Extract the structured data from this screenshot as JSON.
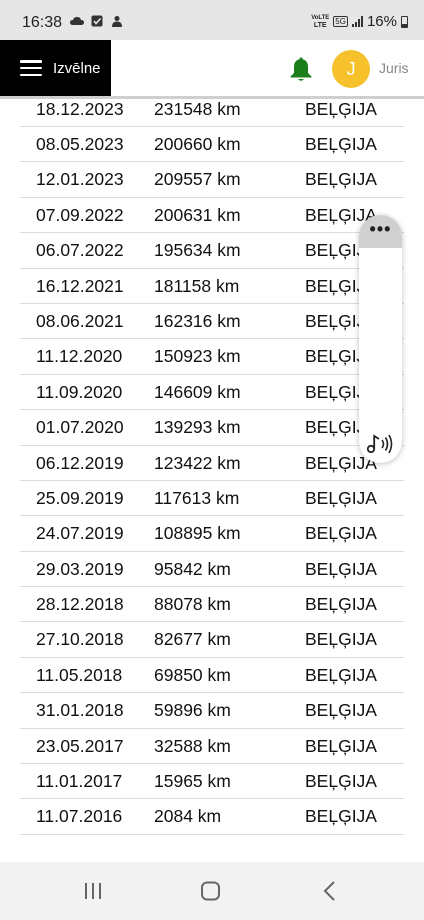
{
  "status_bar": {
    "time": "16:38",
    "network_top": "VoLTE",
    "network_bottom": "LTE",
    "network_type": "5G",
    "battery_percent": "16%"
  },
  "app_bar": {
    "menu_label": "Izvēlne",
    "avatar_initial": "J",
    "user_name": "Juris",
    "bell_color": "#1a7f1a",
    "avatar_color": "#f6c12a"
  },
  "records": [
    {
      "date": "18.12.2023",
      "km": "231548 km",
      "country": "BEĻĢIJA"
    },
    {
      "date": "08.05.2023",
      "km": "200660 km",
      "country": "BEĻĢIJA"
    },
    {
      "date": "12.01.2023",
      "km": "209557 km",
      "country": "BEĻĢIJA"
    },
    {
      "date": "07.09.2022",
      "km": "200631 km",
      "country": "BEĻĢIJA"
    },
    {
      "date": "06.07.2022",
      "km": "195634 km",
      "country": "BEĻĢIJA"
    },
    {
      "date": "16.12.2021",
      "km": "181158 km",
      "country": "BEĻĢIJA"
    },
    {
      "date": "08.06.2021",
      "km": "162316 km",
      "country": "BEĻĢIJA"
    },
    {
      "date": "11.12.2020",
      "km": "150923 km",
      "country": "BEĻĢIJA"
    },
    {
      "date": "11.09.2020",
      "km": "146609 km",
      "country": "BEĻĢIJA"
    },
    {
      "date": "01.07.2020",
      "km": "139293 km",
      "country": "BEĻĢIJA"
    },
    {
      "date": "06.12.2019",
      "km": "123422 km",
      "country": "BEĻĢIJA"
    },
    {
      "date": "25.09.2019",
      "km": "117613 km",
      "country": "BEĻĢIJA"
    },
    {
      "date": "24.07.2019",
      "km": "108895 km",
      "country": "BEĻĢIJA"
    },
    {
      "date": "29.03.2019",
      "km": "95842 km",
      "country": "BEĻĢIJA"
    },
    {
      "date": "28.12.2018",
      "km": "88078 km",
      "country": "BEĻĢIJA"
    },
    {
      "date": "27.10.2018",
      "km": "82677 km",
      "country": "BEĻĢIJA"
    },
    {
      "date": "11.05.2018",
      "km": "69850 km",
      "country": "BEĻĢIJA"
    },
    {
      "date": "31.01.2018",
      "km": "59896 km",
      "country": "BEĻĢIJA"
    },
    {
      "date": "23.05.2017",
      "km": "32588 km",
      "country": "BEĻĢIJA"
    },
    {
      "date": "11.01.2017",
      "km": "15965 km",
      "country": "BEĻĢIJA"
    },
    {
      "date": "11.07.2016",
      "km": "2084 km",
      "country": "BEĻĢIJA"
    }
  ],
  "side_panel": {
    "more_icon": "more-horizontal-icon",
    "sound_icon": "music-note-sound-icon"
  },
  "nav_bar": {
    "items": [
      "recent-apps-icon",
      "home-icon",
      "back-icon"
    ]
  }
}
